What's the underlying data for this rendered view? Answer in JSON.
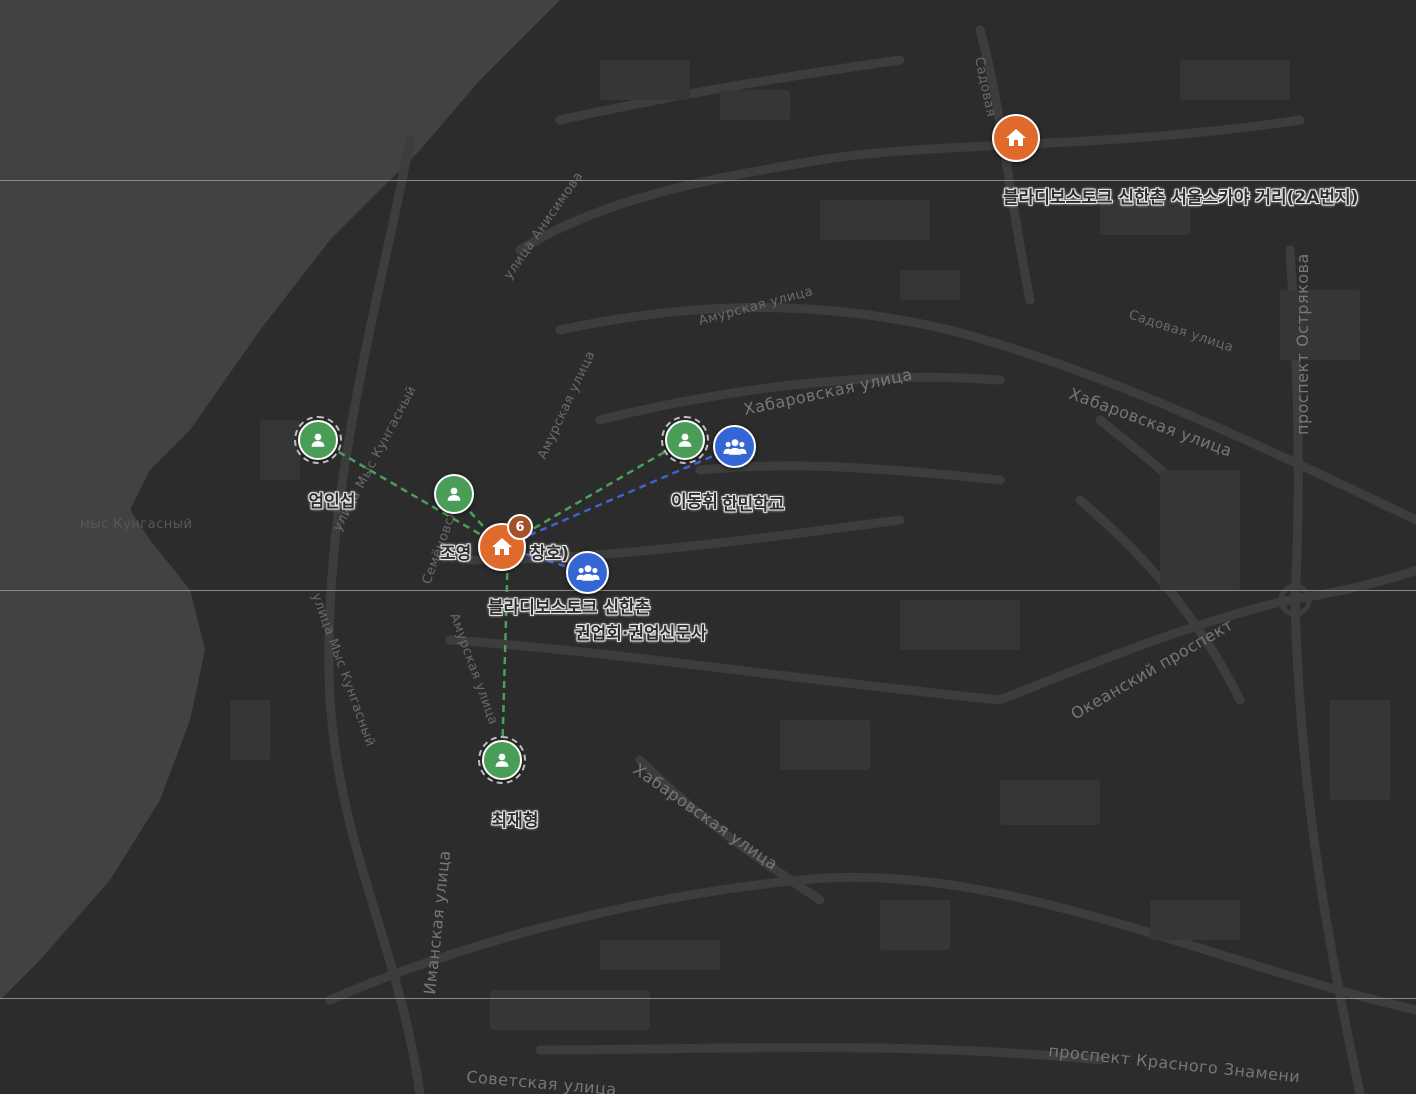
{
  "colors": {
    "person": "#4a9d57",
    "group": "#3566d6",
    "house": "#e06a2c",
    "badge": "#a4502a",
    "link_green": "#4aa05a",
    "link_blue": "#3f63d0"
  },
  "markers": {
    "house_seoul": {
      "label": "블라디보스토크 신한촌 서울스카야 거리(2A번지)",
      "icon": "house-icon"
    },
    "house_main": {
      "label_left": "조영",
      "label_right": "창호)",
      "icon": "house-icon",
      "count": "6"
    },
    "person_eom": {
      "label": "엄인섭",
      "icon": "person-icon"
    },
    "person_plain": {
      "icon": "person-icon"
    },
    "person_lee": {
      "label": "이동휘",
      "icon": "person-icon"
    },
    "person_choi": {
      "label": "최재형",
      "icon": "person-icon"
    },
    "group_school": {
      "label": "한민학교",
      "icon": "group-icon"
    },
    "group_kwon": {
      "label_line1": "블라디보스토크 신한촌",
      "label_line2": "권업회·권업신문사",
      "icon": "group-icon"
    }
  },
  "streets": {
    "anisimova": "улица Анисимова",
    "amurskaya_1": "Амурская улица",
    "amurskaya_2": "Амурская улица",
    "amurskaya_3": "Амурская улица",
    "sadovaya_1": "Садовая улица",
    "sadovaya_2": "Садовая",
    "khabarovskaya_1": "Хабаровская улица",
    "khabarovskaya_2": "Хабаровская улица",
    "khabarovskaya_3": "Хабаровская улица",
    "ostryakova": "проспект Острякова",
    "okeansky": "Океанский проспект",
    "kungasny_1": "улица Мыс Кунгасный",
    "kungasny_2": "улица Мыс Кунгасный",
    "kungasny_3": "мыс Кунгасный",
    "imanskaya": "Иманская улица",
    "sovetskaya": "Советская улица",
    "krasnogo_znameni": "проспект Красного Знамени",
    "semenovskaya": "Семёновская"
  }
}
